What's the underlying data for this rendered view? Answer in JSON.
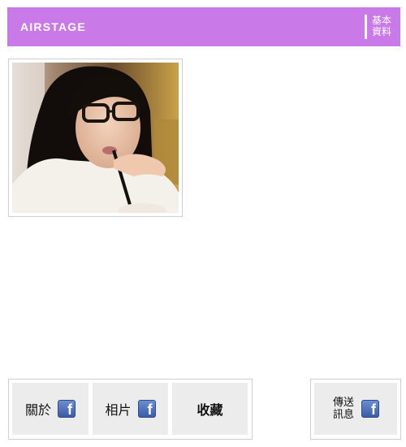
{
  "header": {
    "logo_text": "AIRSTAGE",
    "basic_info_line1": "基本",
    "basic_info_line2": "資料",
    "background_color": "#c97ae8"
  },
  "profile": {
    "photo_alt": "profile-photo"
  },
  "tabs": [
    {
      "label": "關於",
      "icon": "facebook-icon"
    },
    {
      "label": "相片",
      "icon": "facebook-icon"
    },
    {
      "label": "收藏"
    }
  ],
  "message_button": {
    "line1": "傳送",
    "line2": "訊息",
    "icon": "facebook-icon"
  }
}
